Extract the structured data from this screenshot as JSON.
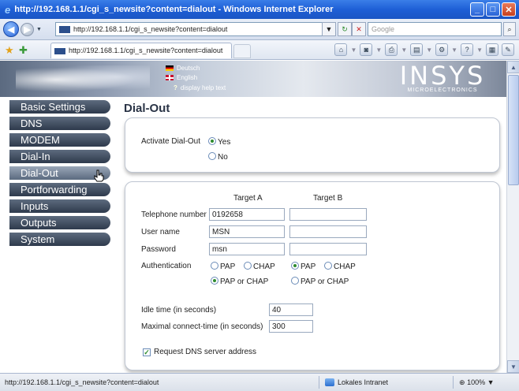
{
  "window": {
    "title": "http://192.168.1.1/cgi_s_newsite?content=dialout - Windows Internet Explorer",
    "min": "_",
    "max": "□",
    "close": "✕"
  },
  "addressbar": {
    "url": "http://192.168.1.1/cgi_s_newsite?content=dialout",
    "search_placeholder": "Google"
  },
  "tab": {
    "label": "http://192.168.1.1/cgi_s_newsite?content=dialout"
  },
  "banner": {
    "lang_de": "Deutsch",
    "lang_en": "English",
    "help": "display help text",
    "logo_big": "INSYS",
    "logo_small": "MICROELECTRONICS"
  },
  "nav": {
    "items": [
      {
        "label": "Basic Settings",
        "active": false
      },
      {
        "label": "DNS",
        "active": false
      },
      {
        "label": "MODEM",
        "active": false
      },
      {
        "label": "Dial-In",
        "active": false
      },
      {
        "label": "Dial-Out",
        "active": true
      },
      {
        "label": "Portforwarding",
        "active": false
      },
      {
        "label": "Inputs",
        "active": false
      },
      {
        "label": "Outputs",
        "active": false
      },
      {
        "label": "System",
        "active": false
      }
    ]
  },
  "content": {
    "title": "Dial-Out",
    "activate_label": "Activate Dial-Out",
    "activate_yes": "Yes",
    "activate_no": "No",
    "activate_value": "Yes",
    "target_a": "Target A",
    "target_b": "Target B",
    "phone_label": "Telephone number",
    "phone_a": "0192658",
    "phone_b": "",
    "user_label": "User name",
    "user_a": "MSN",
    "user_b": "",
    "pass_label": "Password",
    "pass_a": "msn",
    "pass_b": "",
    "auth_label": "Authentication",
    "auth_pap": "PAP",
    "auth_chap": "CHAP",
    "auth_both": "PAP or CHAP",
    "auth_a_value": "PAP or CHAP",
    "auth_b_value": "PAP",
    "idle_label": "Idle time (in seconds)",
    "idle_value": "40",
    "maxconn_label": "Maximal connect-time (in seconds)",
    "maxconn_value": "300",
    "dns_label": "Request DNS server address",
    "dns_checked": true
  },
  "status": {
    "url": "http://192.168.1.1/cgi_s_newsite?content=dialout",
    "zone": "Lokales Intranet",
    "zoom": "100%"
  }
}
